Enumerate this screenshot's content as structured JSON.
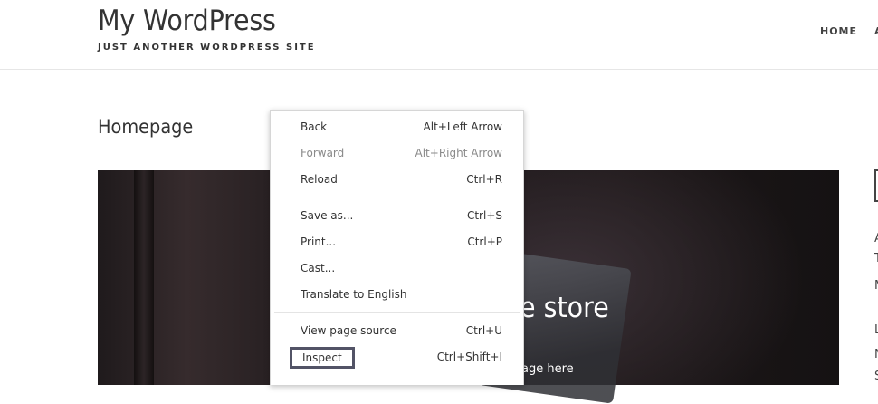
{
  "header": {
    "site_title": "My WordPress",
    "tagline": "JUST ANOTHER WORDPRESS SITE",
    "nav": [
      {
        "label": "HOME"
      },
      {
        "label": "A"
      }
    ]
  },
  "page": {
    "title": "Homepage",
    "hero": {
      "heading": "e store",
      "subheading": "age here"
    }
  },
  "sidebar": {
    "fragments": [
      "A",
      "T",
      "M",
      "L",
      "N",
      "S"
    ]
  },
  "context_menu": {
    "items": [
      {
        "label": "Back",
        "shortcut": "Alt+Left Arrow",
        "enabled": true
      },
      {
        "label": "Forward",
        "shortcut": "Alt+Right Arrow",
        "enabled": false
      },
      {
        "label": "Reload",
        "shortcut": "Ctrl+R",
        "enabled": true
      },
      {
        "label": "Save as...",
        "shortcut": "Ctrl+S",
        "enabled": true
      },
      {
        "label": "Print...",
        "shortcut": "Ctrl+P",
        "enabled": true
      },
      {
        "label": "Cast...",
        "shortcut": "",
        "enabled": true
      },
      {
        "label": "Translate to English",
        "shortcut": "",
        "enabled": true
      },
      {
        "label": "View page source",
        "shortcut": "Ctrl+U",
        "enabled": true
      },
      {
        "label": "Inspect",
        "shortcut": "Ctrl+Shift+I",
        "enabled": true,
        "highlighted": true
      }
    ]
  },
  "colors": {
    "text": "#333333",
    "disabled_text": "#8a8a8a",
    "highlight_border": "#525366"
  }
}
